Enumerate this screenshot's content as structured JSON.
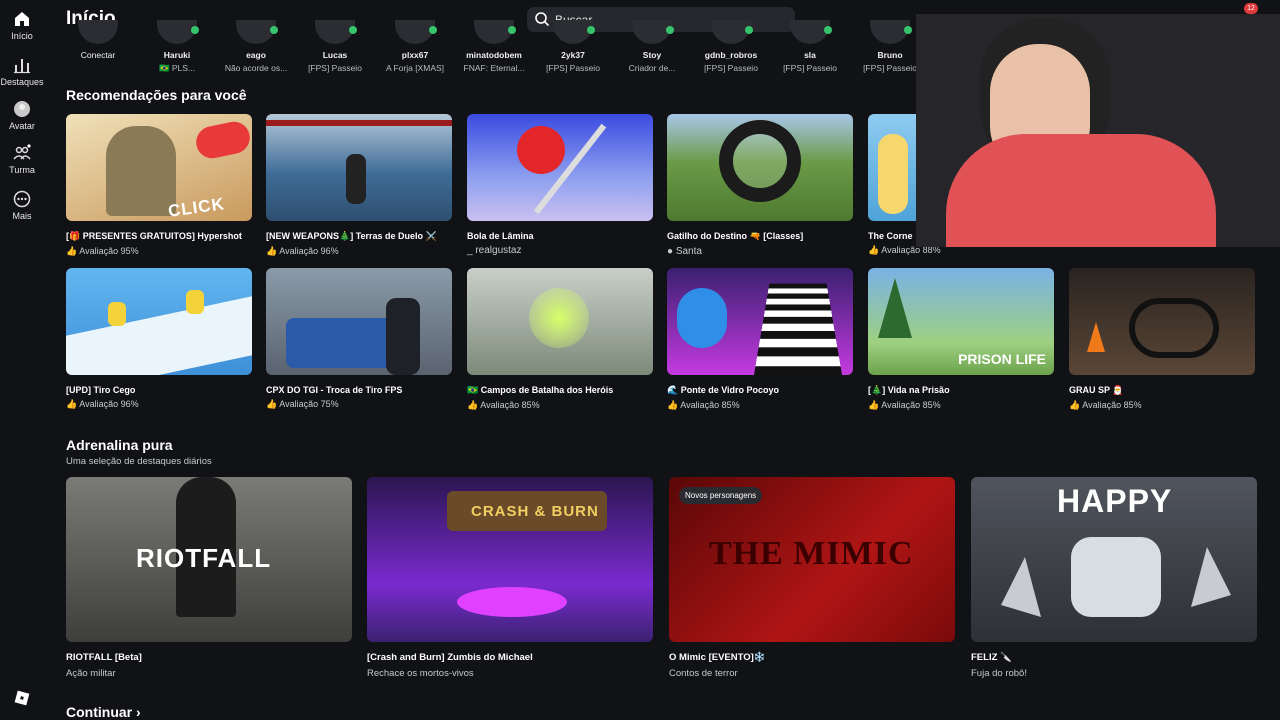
{
  "sidebar": {
    "items": [
      {
        "label": "Início",
        "icon": "home-icon"
      },
      {
        "label": "Destaques",
        "icon": "chart-icon"
      },
      {
        "label": "Avatar",
        "icon": "avatar-icon"
      },
      {
        "label": "Turma",
        "icon": "people-icon"
      },
      {
        "label": "Mais",
        "icon": "more-icon"
      }
    ]
  },
  "header": {
    "title": "Início",
    "search_placeholder": "Buscar",
    "notification_count": "12"
  },
  "friends": [
    {
      "name": "Conectar",
      "status": ""
    },
    {
      "name": "Haruki",
      "status": "🇧🇷 PLS..."
    },
    {
      "name": "eago",
      "status": "Não acorde os..."
    },
    {
      "name": "Lucas",
      "status": "[FPS] Passeio"
    },
    {
      "name": "plxx67",
      "status": "A Forja [XMAS]"
    },
    {
      "name": "minatodobem",
      "status": "FNAF: Eternal..."
    },
    {
      "name": "2yk37",
      "status": "[FPS] Passeio"
    },
    {
      "name": "Stoy",
      "status": "Criador de..."
    },
    {
      "name": "gdnb_robros",
      "status": "[FPS] Passeio"
    },
    {
      "name": "sla",
      "status": "[FPS] Passeio"
    },
    {
      "name": "Bruno",
      "status": "[FPS] Passeio"
    }
  ],
  "recommendations": {
    "title": "Recomendações para você",
    "row1": [
      {
        "title": "[🎁 PRESENTES GRATUITOS] Hypershot",
        "rating": "Avaliação 95%",
        "thumb_text": "CLICK",
        "bg": "#e8d2a0"
      },
      {
        "title": "[NEW WEAPONS🎄] Terras de Duelo ⚔️",
        "rating": "Avaliação 96%",
        "thumb_text": "",
        "bg": "#4f7ea8"
      },
      {
        "title": "Bola de Lâmina",
        "rating": "_ realgustaz",
        "thumb_text": "",
        "bg": "#5f6ee8"
      },
      {
        "title": "Gatilho do Destino 🔫 [Classes]",
        "rating": "Santa",
        "thumb_text": "",
        "bg": "#5e8a3a"
      },
      {
        "title": "The Corne",
        "rating": "Avaliação 88%",
        "thumb_text": "",
        "bg": "#4fa3d8"
      }
    ],
    "row2": [
      {
        "title": "[UPD] Tiro Cego",
        "rating": "Avaliação 96%",
        "thumb_text": "",
        "bg": "#5aaee8"
      },
      {
        "title": "CPX DO TGI - Troca de Tiro FPS",
        "rating": "Avaliação 75%",
        "thumb_text": "",
        "bg": "#6b7a88"
      },
      {
        "title": "🇧🇷 Campos de Batalha dos Heróis",
        "rating": "Avaliação 85%",
        "thumb_text": "",
        "bg": "#7f8c7a"
      },
      {
        "title": "🌊 Ponte de Vidro Pocoyo",
        "rating": "Avaliação 85%",
        "thumb_text": "",
        "bg": "#c43ae0"
      },
      {
        "title": "[🎄] Vida na Prisão",
        "rating": "Avaliação 85%",
        "thumb_text": "PRISON LIFE",
        "bg": "#6aa4d8"
      },
      {
        "title": "GRAU SP 🎅",
        "rating": "Avaliação 85%",
        "thumb_text": "",
        "bg": "#4a3a32"
      }
    ]
  },
  "adrenaline": {
    "title": "Adrenalina pura",
    "subtitle": "Uma seleção de destaques diários",
    "items": [
      {
        "title": "RIOTFALL [Beta]",
        "sub": "Ação militar",
        "thumb_text": "RIOTFALL",
        "badge": "",
        "bg": "#5a5a58"
      },
      {
        "title": "[Crash and Burn] Zumbis do Michael",
        "sub": "Rechace os mortos-vivos",
        "thumb_text": "CRASH & BURN",
        "badge": "",
        "bg": "#3b2270"
      },
      {
        "title": "O Mimic [EVENTO]❄️",
        "sub": "Contos de terror",
        "thumb_text": "THE MIMIC",
        "badge": "Novos personagens",
        "bg": "#8a0d0d"
      },
      {
        "title": "FELIZ 🔪",
        "sub": "Fuja do robô!",
        "thumb_text": "HAPPY",
        "badge": "",
        "bg": "#3c4048"
      }
    ]
  },
  "continue_label": "Continuar",
  "rating_prefix_icon": "thumbs-up-icon"
}
